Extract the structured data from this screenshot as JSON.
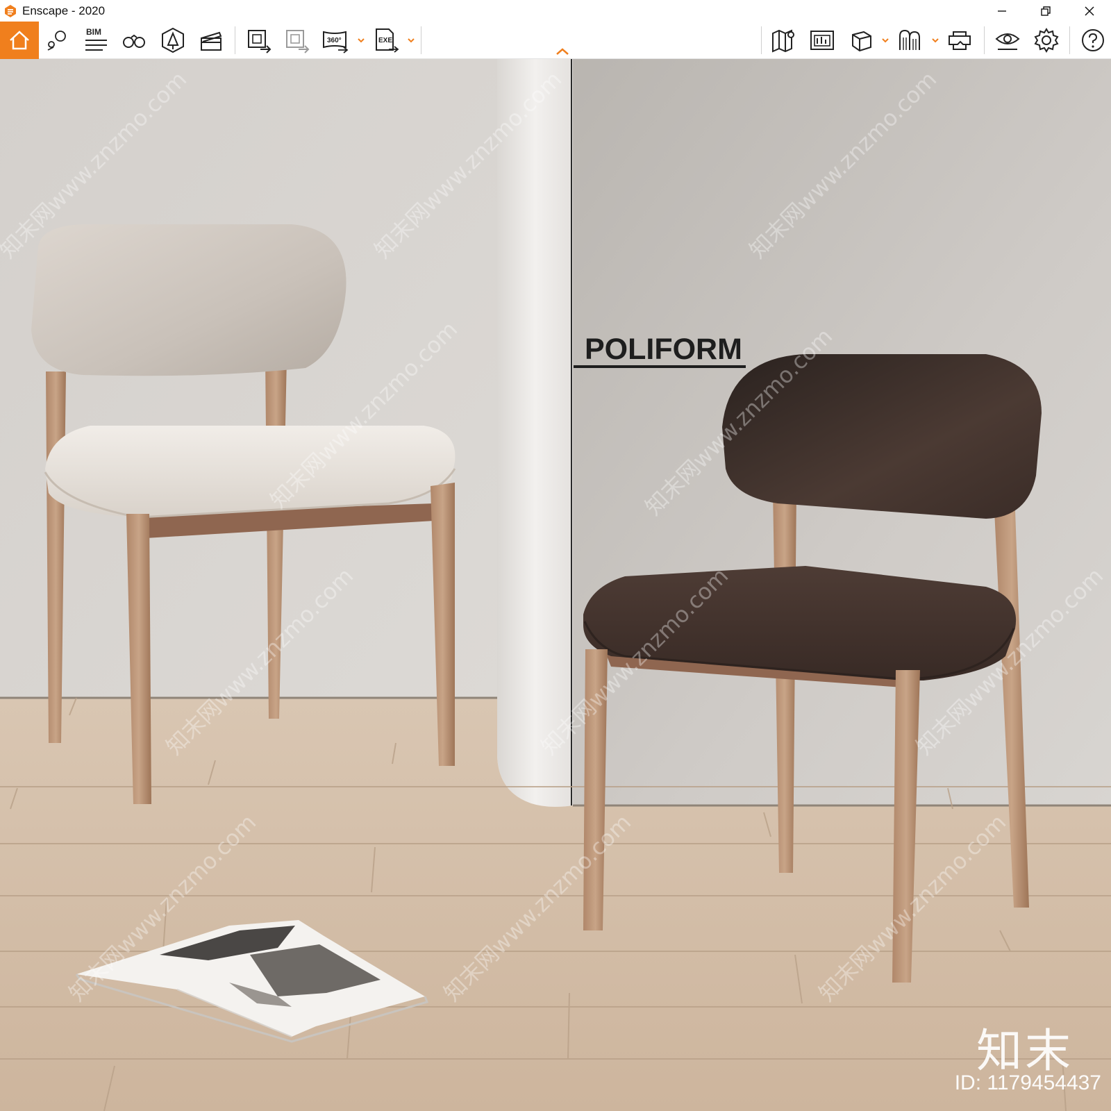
{
  "window": {
    "title": "Enscape - 2020",
    "minimize_icon": "minimize-icon",
    "restore_icon": "restore-icon",
    "close_icon": "close-icon"
  },
  "toolbar": {
    "accent_color": "#f07f1d",
    "left_tools": [
      {
        "name": "home",
        "icon": "home-icon"
      },
      {
        "name": "views-and-locations",
        "icon": "location-pin-icon"
      },
      {
        "name": "bim",
        "icon": "bim-icon",
        "label": "BIM"
      },
      {
        "name": "orthographic",
        "icon": "binoculars-icon"
      },
      {
        "name": "atmosphere",
        "icon": "atmosphere-icon"
      },
      {
        "name": "video-editor",
        "icon": "clapperboard-icon"
      },
      {
        "name": "batch-render",
        "icon": "batch-render-icon"
      },
      {
        "name": "export-images",
        "icon": "export-images-icon"
      },
      {
        "name": "panorama",
        "icon": "panorama-icon",
        "label": "360°"
      },
      {
        "name": "export-exe",
        "icon": "exe-export-icon",
        "label": "EXE"
      }
    ],
    "right_tools": [
      {
        "name": "map",
        "icon": "map-icon"
      },
      {
        "name": "capture",
        "icon": "capture-icon"
      },
      {
        "name": "asset-library",
        "icon": "cube-icon"
      },
      {
        "name": "material-editor",
        "icon": "material-icon"
      },
      {
        "name": "vr-headset",
        "icon": "vr-headset-icon"
      },
      {
        "name": "visual-settings",
        "icon": "eye-icon"
      },
      {
        "name": "settings",
        "icon": "gear-icon"
      },
      {
        "name": "help",
        "icon": "help-icon"
      }
    ]
  },
  "scene": {
    "sign_text": "POLIFORM",
    "brand_mark": "知末",
    "id_label": "ID: 1179454437",
    "watermark": "知末网www.znzmo.com"
  }
}
